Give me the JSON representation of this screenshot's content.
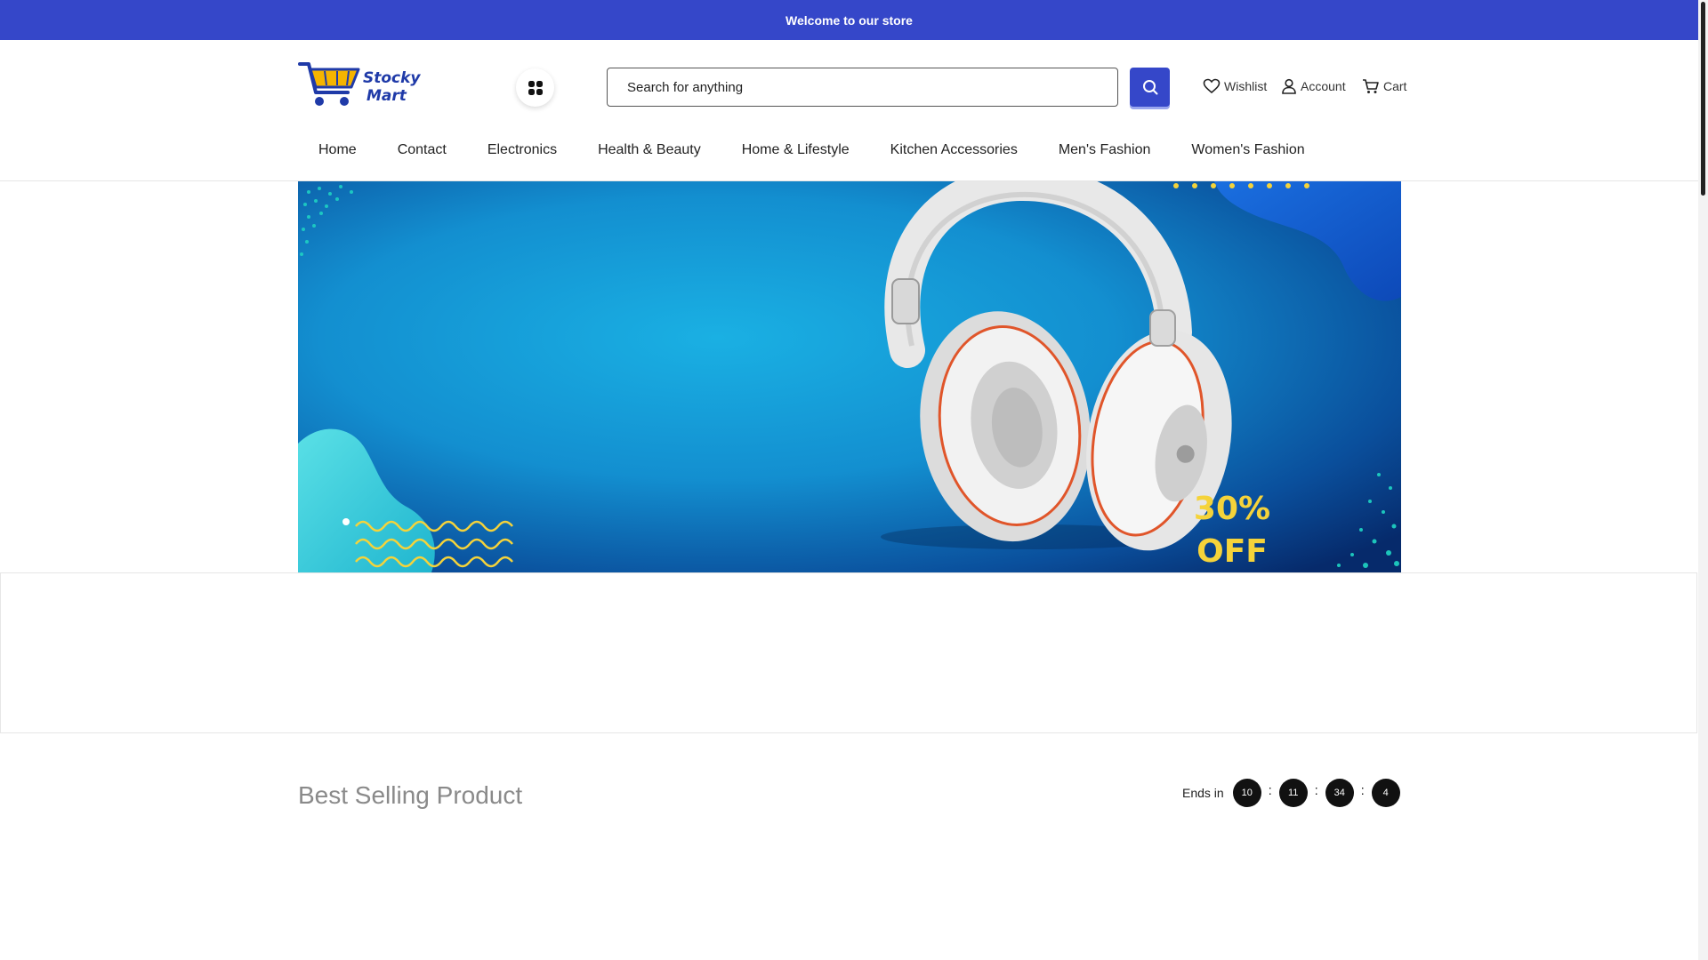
{
  "announcement": "Welcome to our store",
  "brand": {
    "logo_line1": "Stocky",
    "logo_line2": "Mart",
    "primary_color": "#3547c9",
    "accent_color": "#f5b400"
  },
  "header": {
    "categories_icon": "grid-icon",
    "search": {
      "placeholder": "Search for anything",
      "value": ""
    },
    "search_icon": "search-icon",
    "wishlist": "Wishlist",
    "account": "Account",
    "cart": "Cart"
  },
  "nav": [
    "Home",
    "Contact",
    "Electronics",
    "Health & Beauty",
    "Home & Lifestyle",
    "Kitchen Accessories",
    "Men's Fashion",
    "Women's Fashion"
  ],
  "hero": {
    "promo_line1": "30%",
    "promo_line2": "OFF",
    "product": "headphones-image"
  },
  "best_selling": {
    "title": "Best Selling Product",
    "ends_label": "Ends in",
    "countdown": [
      "10",
      "11",
      "34",
      "4"
    ]
  }
}
